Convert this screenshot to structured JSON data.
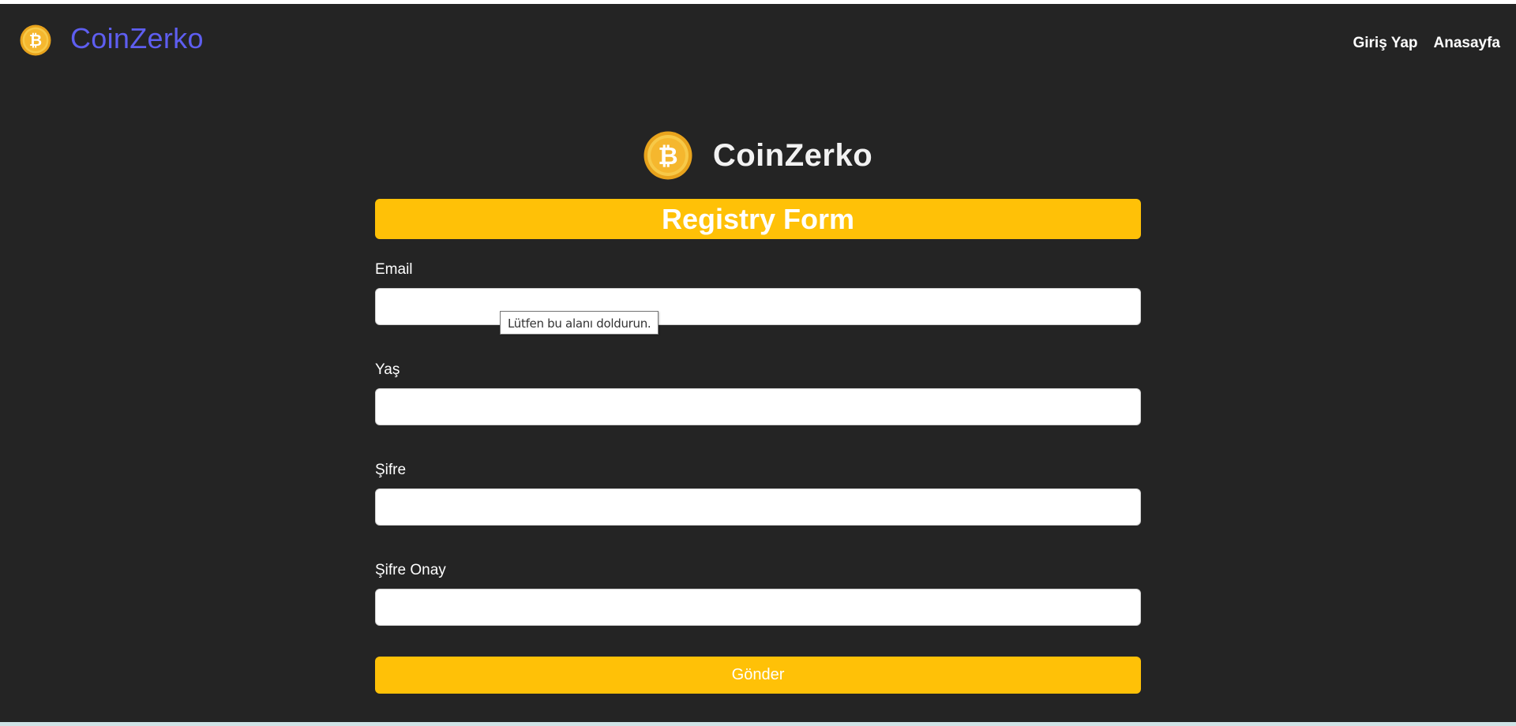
{
  "navbar": {
    "brand": "CoinZerko",
    "links": [
      {
        "label": "Giriş Yap"
      },
      {
        "label": "Anasayfa"
      }
    ]
  },
  "hero": {
    "title": "CoinZerko"
  },
  "form": {
    "header": "Registry Form",
    "fields": [
      {
        "label": "Email",
        "value": ""
      },
      {
        "label": "Yaş",
        "value": ""
      },
      {
        "label": "Şifre",
        "value": ""
      },
      {
        "label": "Şifre Onay",
        "value": ""
      }
    ],
    "submit_label": "Gönder",
    "validation_tooltip": "Lütfen bu alanı doldurun."
  },
  "colors": {
    "background": "#242424",
    "accent": "#ffc107",
    "brand": "#5e5ef0"
  },
  "icons": {
    "logo": "bitcoin-coin-icon"
  }
}
